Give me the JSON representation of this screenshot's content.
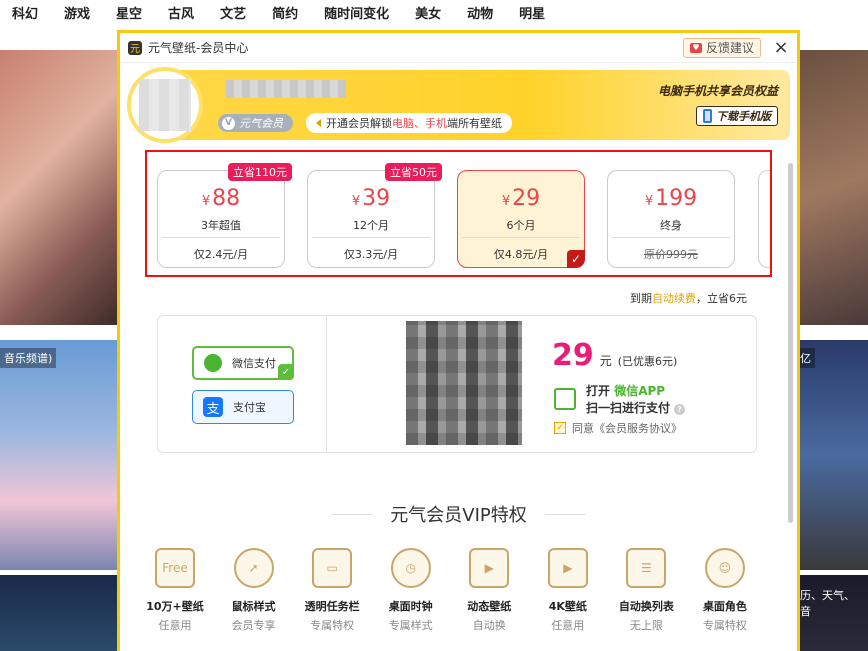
{
  "topnav": [
    "科幻",
    "游戏",
    "星空",
    "古风",
    "文艺",
    "简约",
    "随时间变化",
    "美女",
    "动物",
    "明星"
  ],
  "bg_tags": {
    "left": "音乐频谱)",
    "right": "亿",
    "right_bottom": "历、天气、音"
  },
  "dialog": {
    "title": "元气壁纸-会员中心",
    "feedback": "反馈建议",
    "close": "×"
  },
  "header": {
    "vip_badge": "元气会员",
    "unlock_prefix": "开通会员解锁 ",
    "unlock_hl": "电脑、手机",
    "unlock_suffix": " 端所有壁纸",
    "share": "电脑手机共享会员权益",
    "download": "下载手机版"
  },
  "plans": [
    {
      "price": "88",
      "period": "3年超值",
      "unit": "仅2.4元/月",
      "save": "立省110元",
      "selected": false
    },
    {
      "price": "39",
      "period": "12个月",
      "unit": "仅3.3元/月",
      "save": "立省50元",
      "selected": false
    },
    {
      "price": "29",
      "period": "6个月",
      "unit": "仅4.8元/月",
      "save": "",
      "selected": true
    },
    {
      "price": "199",
      "period": "终身",
      "unit": "原价999元",
      "save": "",
      "selected": false
    }
  ],
  "currency": "¥",
  "renew": {
    "prefix": "到期",
    "hl": "自动续费",
    "suffix": "，立省6元"
  },
  "payment": {
    "wechat": "微信支付",
    "alipay": "支付宝",
    "amount": "29",
    "yuan": "元",
    "discount": "(已优惠6元)",
    "open_prefix": "打开 ",
    "open_app": "微信APP",
    "scan": "扫一扫进行支付",
    "agree": "同意《会员服务协议》"
  },
  "vip_title": "元气会员VIP特权",
  "perks": [
    {
      "name": "10万+壁纸",
      "desc": "任意用",
      "icon": "free-image-icon"
    },
    {
      "name": "鼠标样式",
      "desc": "会员专享",
      "icon": "cursor-icon"
    },
    {
      "name": "透明任务栏",
      "desc": "专属特权",
      "icon": "taskbar-icon"
    },
    {
      "name": "桌面时钟",
      "desc": "专属样式",
      "icon": "clock-icon"
    },
    {
      "name": "动态壁纸",
      "desc": "自动换",
      "icon": "video-icon"
    },
    {
      "name": "4K壁纸",
      "desc": "任意用",
      "icon": "4k-icon"
    },
    {
      "name": "自动换列表",
      "desc": "无上限",
      "icon": "playlist-icon"
    },
    {
      "name": "桌面角色",
      "desc": "专属特权",
      "icon": "character-icon"
    }
  ],
  "colors": {
    "accent": "#f7c90c",
    "price": "#e8454a",
    "save": "#e81d5a",
    "wechat": "#4ab530",
    "alipay": "#1677ff"
  }
}
